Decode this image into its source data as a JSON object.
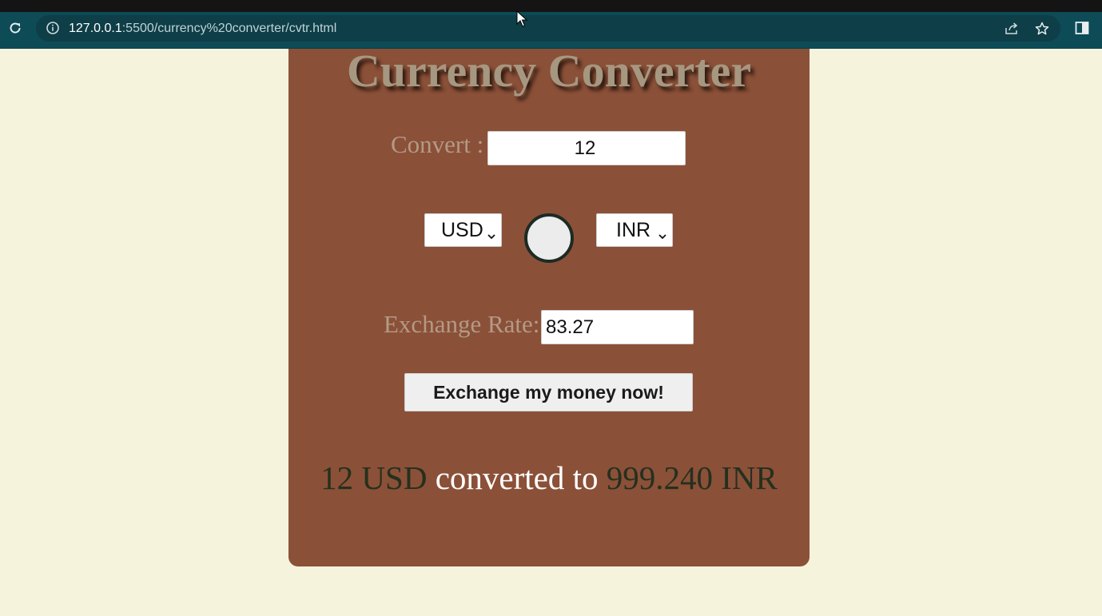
{
  "browser": {
    "url_host": "127.0.0.1",
    "url_rest": ":5500/currency%20converter/cvtr.html",
    "icons": [
      "reload-icon",
      "info-icon",
      "share-icon",
      "star-icon",
      "side-panel-icon"
    ]
  },
  "app": {
    "title": "Currency Converter",
    "convert_label": "Convert :",
    "amount_value": "12",
    "from_currency": "USD",
    "to_currency": "INR",
    "rate_label": "Exchange Rate:",
    "rate_value": "83.27",
    "button_label": "Exchange my money now!",
    "result": {
      "from_amount": "12 USD",
      "middle": "converted to",
      "to_amount": "999.240 INR"
    }
  },
  "colors": {
    "page_bg": "#f6f3dd",
    "card_bg": "#8b5038",
    "browser_toolbar": "#0d4b57",
    "result_numbers": "#25301e"
  }
}
